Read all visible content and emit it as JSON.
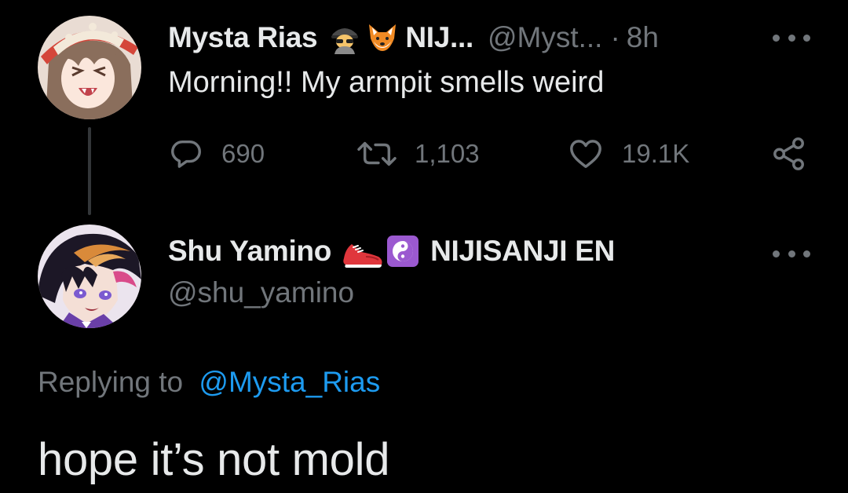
{
  "parent_tweet": {
    "display_name": "Mysta Rias",
    "name_emojis": [
      "detective-emoji",
      "fox-emoji"
    ],
    "affiliation": "NIJ...",
    "handle": "@Myst...",
    "separator": "·",
    "time": "8h",
    "text": "Morning!! My armpit smells weird",
    "actions": {
      "reply_count": "690",
      "retweet_count": "1,103",
      "like_count": "19.1K"
    },
    "icons": [
      "reply-icon",
      "retweet-icon",
      "like-icon",
      "share-icon",
      "more-icon"
    ]
  },
  "focused_tweet": {
    "display_name": "Shu Yamino",
    "name_emojis": [
      "running-shoe-emoji",
      "yin-yang-emoji"
    ],
    "affiliation": "NIJISANJI EN",
    "handle": "@shu_yamino",
    "replying_prefix": "Replying to",
    "replying_to": "@Mysta_Rias",
    "text": "hope it’s not mold"
  },
  "colors": {
    "background": "#000000",
    "primary_text": "#e7e9ea",
    "secondary_text": "#71767b",
    "link": "#1d9bf0",
    "thread_line": "#333639"
  }
}
